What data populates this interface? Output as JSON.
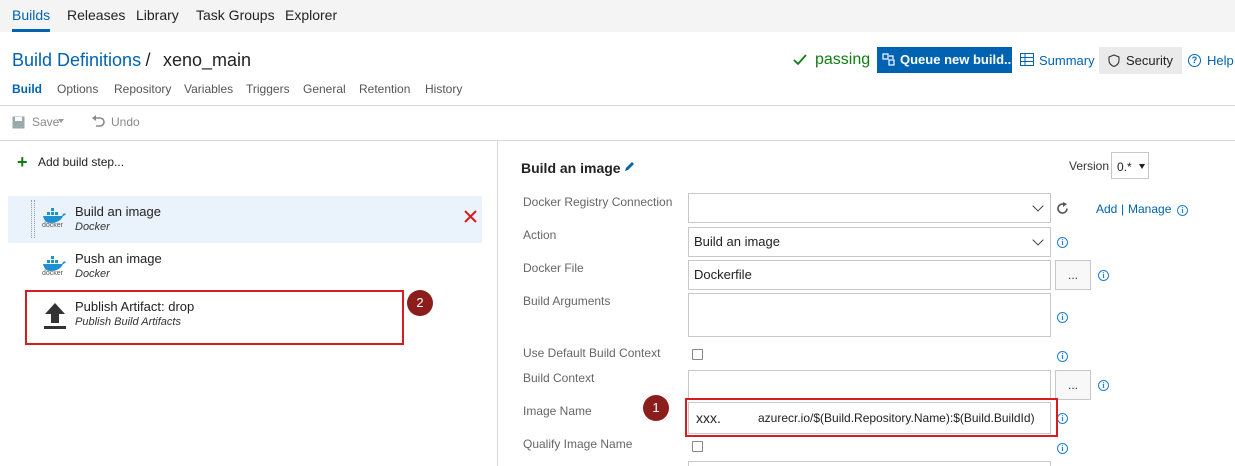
{
  "topnav": {
    "items": [
      "Builds",
      "Releases",
      "Library",
      "Task Groups",
      "Explorer"
    ]
  },
  "header": {
    "breadcrumb_link": "Build Definitions",
    "breadcrumb_sep": "/",
    "definition_name": "xeno_main",
    "status": "passing",
    "queue_button": "Queue new build...",
    "summary": "Summary",
    "security": "Security",
    "help": "Help"
  },
  "subtabs": [
    "Build",
    "Options",
    "Repository",
    "Variables",
    "Triggers",
    "General",
    "Retention",
    "History"
  ],
  "toolbar": {
    "save": "Save",
    "undo": "Undo"
  },
  "left": {
    "add_step": "Add build step...",
    "steps": [
      {
        "title": "Build an image",
        "subtitle": "Docker",
        "icon": "docker-icon"
      },
      {
        "title": "Push an image",
        "subtitle": "Docker",
        "icon": "docker-icon"
      },
      {
        "title": "Publish Artifact: drop",
        "subtitle": "Publish Build Artifacts",
        "icon": "upload-arrow-icon"
      }
    ],
    "docker_caption": "docker"
  },
  "right": {
    "title": "Build an image",
    "version_label": "Version",
    "version_value": "0.*",
    "add": "Add",
    "manage_sep": "|",
    "manage": "Manage",
    "labels": {
      "registry": "Docker Registry Connection",
      "action": "Action",
      "docker_file": "Docker File",
      "build_args": "Build Arguments",
      "use_default_context": "Use Default Build Context",
      "build_context": "Build Context",
      "image_name": "Image Name",
      "qualify_image_name": "Qualify Image Name"
    },
    "values": {
      "action": "Build an image",
      "docker_file": "Dockerfile",
      "image_name_prefix": "xxx.",
      "image_name_rest": "azurecr.io/$(Build.Repository.Name):$(Build.BuildId)",
      "dots": "..."
    }
  },
  "callouts": {
    "one": "1",
    "two": "2"
  },
  "colors": {
    "accent": "#0063b1",
    "callout": "#8c1d1d",
    "highlight": "#d61e1e",
    "passing": "#107c10"
  }
}
